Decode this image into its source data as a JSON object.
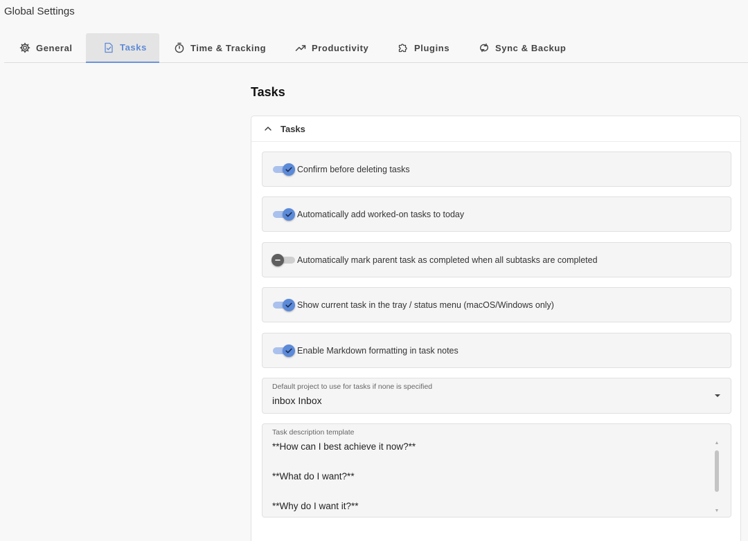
{
  "window": {
    "title": "Global Settings"
  },
  "tabs": [
    {
      "label": "General",
      "icon": "gear-icon"
    },
    {
      "label": "Tasks",
      "icon": "task-icon",
      "active": true
    },
    {
      "label": "Time & Tracking",
      "icon": "timer-icon"
    },
    {
      "label": "Productivity",
      "icon": "trending-up-icon"
    },
    {
      "label": "Plugins",
      "icon": "puzzle-icon"
    },
    {
      "label": "Sync & Backup",
      "icon": "sync-icon"
    }
  ],
  "page": {
    "title": "Tasks"
  },
  "section": {
    "title": "Tasks",
    "expanded": true,
    "toggles": [
      {
        "label": "Confirm before deleting tasks",
        "checked": true
      },
      {
        "label": "Automatically add worked-on tasks to today",
        "checked": true
      },
      {
        "label": "Automatically mark parent task as completed when all subtasks are completed",
        "checked": false
      },
      {
        "label": "Show current task in the tray / status menu (macOS/Windows only)",
        "checked": true
      },
      {
        "label": "Enable Markdown formatting in task notes",
        "checked": true
      }
    ],
    "default_project": {
      "label": "Default project to use for tasks if none is specified",
      "value": "inbox Inbox"
    },
    "description_template": {
      "label": "Task description template",
      "lines": [
        "**How can I best achieve it now?**",
        "",
        "**What do I want?**",
        "",
        "**Why do I want it?**"
      ]
    }
  },
  "colors": {
    "accent": "#5b8ad9",
    "accent_light": "#a9c1ec",
    "toggle_off": "#5e5e5e",
    "background": "#f8f8f8"
  }
}
